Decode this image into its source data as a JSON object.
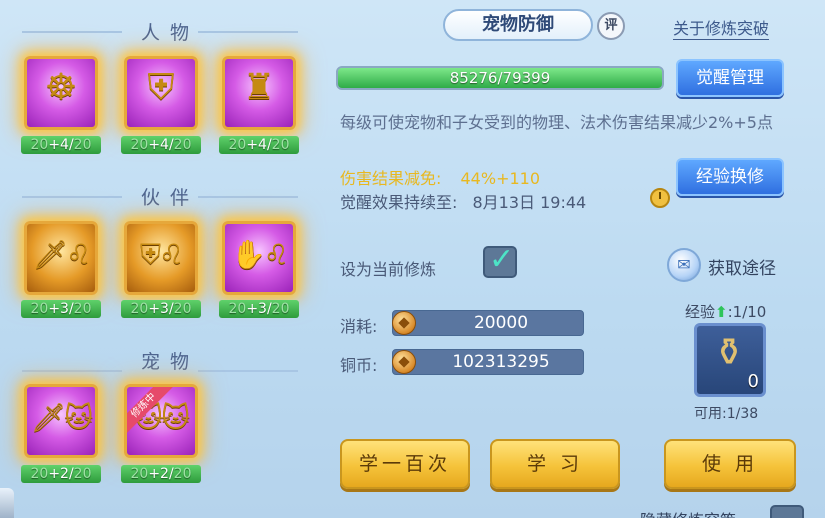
{
  "sections": {
    "character": {
      "title": "人物"
    },
    "partner": {
      "title": "伙伴"
    },
    "pet": {
      "title": "宠物"
    }
  },
  "cards": {
    "character": [
      {
        "icon": "meditating-figure-icon",
        "level_cur": "20",
        "level_add": "+4",
        "level_max": "20"
      },
      {
        "icon": "shield-warrior-icon",
        "level_cur": "20",
        "level_add": "+4",
        "level_max": "20"
      },
      {
        "icon": "armored-warrior-icon",
        "level_cur": "20",
        "level_add": "+4",
        "level_max": "20"
      }
    ],
    "partner": [
      {
        "icon": "sword-lion-icon",
        "level_cur": "20",
        "level_add": "+3",
        "level_max": "20"
      },
      {
        "icon": "shield-lion-icon",
        "level_cur": "20",
        "level_add": "+3",
        "level_max": "20"
      },
      {
        "icon": "armor-lion-icon",
        "level_cur": "20",
        "level_add": "+3",
        "level_max": "20"
      }
    ],
    "pet": [
      {
        "icon": "sword-cat-icon",
        "level_cur": "20",
        "level_add": "+2",
        "level_max": "20"
      },
      {
        "icon": "cat-training-icon",
        "level_cur": "20",
        "level_add": "+2",
        "level_max": "20",
        "ribbon": "修炼中"
      }
    ]
  },
  "header": {
    "title": "宠物防御",
    "badge": "评",
    "about_link": "关于修炼突破"
  },
  "exp_bar": {
    "text": "85276/79399",
    "fill_fraction": 1.0
  },
  "buttons": {
    "awaken_manage": "觉醒管理",
    "exp_exchange": "经验换修",
    "learn_100": "学一百次",
    "learn": "学 习",
    "use": "使 用"
  },
  "description": "每级可使宠物和子女受到的物理、法术伤害结果减少2%+5点",
  "stats": {
    "reduction_label": "伤害结果减免:",
    "reduction_value": "44%+110",
    "awaken_label": "觉醒效果持续至:",
    "awaken_value": "8月13日 19:44"
  },
  "current_training": {
    "label": "设为当前修炼",
    "checked": true
  },
  "gain_path": "获取途径",
  "cost": {
    "label": "消耗:",
    "value": "20000"
  },
  "copper": {
    "label": "铜币:",
    "value": "102313295"
  },
  "item": {
    "exp_label": "经验",
    "exp_value": ":1/10",
    "qty": "0",
    "available": "可用:1/38"
  },
  "hide_label": "隐藏修炼突策",
  "colors": {
    "accent_blue": "#2f6fe0",
    "gold": "#f5c33a",
    "green": "#2fab47"
  }
}
